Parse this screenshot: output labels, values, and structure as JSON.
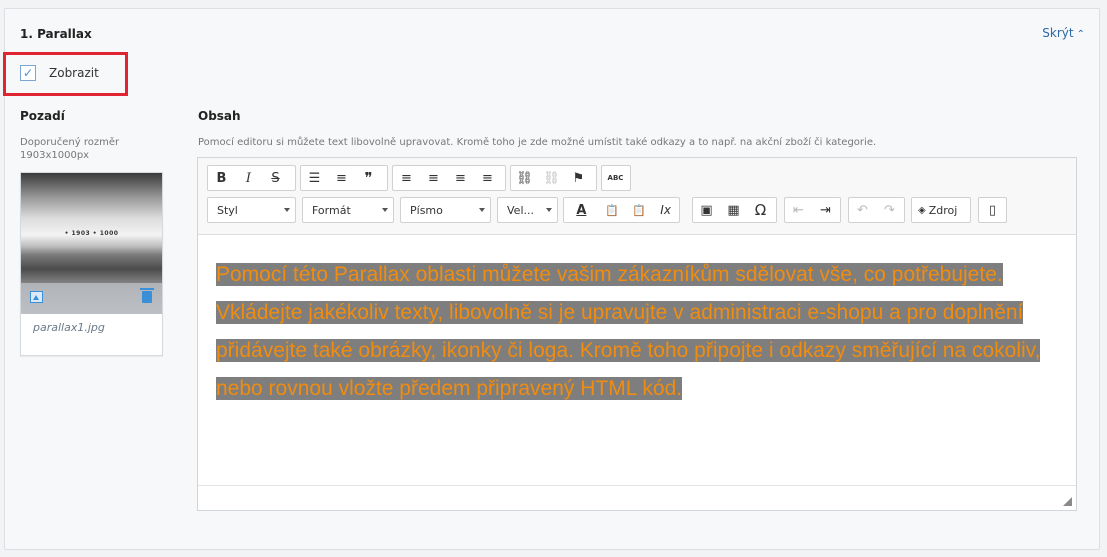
{
  "section": {
    "title": "1. Parallax",
    "toggle_label": "Skrýt",
    "toggle_icon": "chevron-up-icon"
  },
  "show": {
    "label": "Zobrazit",
    "checked": true,
    "check_glyph": "✓"
  },
  "background": {
    "heading": "Pozadí",
    "hint": "Doporučený rozměr 1903x1000px",
    "image": {
      "filename": "parallax1.jpg",
      "caption": "• 1903 • 1000"
    }
  },
  "content": {
    "heading": "Obsah",
    "hint": "Pomocí editoru si můžete text libovolně upravovat. Kromě toho je zde možné umístit také odkazy a to např. na akční zboží či kategorie.",
    "text": "Pomocí této Parallax oblasti můžete vašim zákazníkům sdělovat vše, co potřebujete. Vkládejte jakékoliv texty, libovolně si je upravujte v administraci e-shopu a pro doplnění přidávejte také obrázky, ikonky či loga. Kromě toho připojte i odkazy směřující na cokoliv, nebo rovnou vložte předem připravený HTML kód.",
    "text_color": "#f08c10",
    "highlight_color": "#7e7e7e"
  },
  "toolbar": {
    "glyphs": {
      "bold": "B",
      "italic": "I",
      "strike": "S",
      "bullets": "☰",
      "numbered": "≡",
      "quote": "❞",
      "align_left": "≡",
      "align_center": "≡",
      "align_right": "≡",
      "justify": "≡",
      "link": "⛓",
      "unlink": "⛓",
      "anchor": "⚑",
      "spellcheck": "ABC",
      "text_color": "A",
      "paste": "📋",
      "paste_text": "📋",
      "clear_format": "Ix",
      "image": "▣",
      "table": "▦",
      "special_char": "Ω",
      "outdent": "⇤",
      "indent": "⇥",
      "undo": "↶",
      "redo": "↷",
      "source_icon": "◈",
      "maximize": "▯"
    },
    "style_label": "Styl",
    "format_label": "Formát",
    "font_label": "Písmo",
    "size_label": "Vel...",
    "source_label": "Zdroj"
  }
}
